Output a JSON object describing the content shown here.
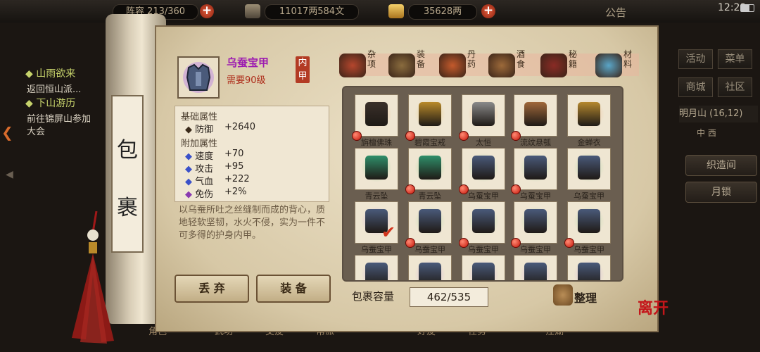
{
  "topbar": {
    "partial_text": "阵容 213/360",
    "money": "11017两584文",
    "gold": "35628两",
    "notice": "公告",
    "time": "12:29"
  },
  "quests": [
    {
      "title": "◆ 山雨欲来",
      "sub": "返回恒山派..."
    },
    {
      "title": "◆ 下山游历",
      "sub": "前往锦屏山参加",
      "sub2": "大会"
    }
  ],
  "right_menu": {
    "row1": [
      "活动",
      "菜单"
    ],
    "row2": [
      "商城",
      "社区"
    ],
    "location": "明月山 (16,12)",
    "compass": "中 西",
    "buttons": [
      "织造间",
      "月锁"
    ]
  },
  "bottom_nav": [
    "角色",
    "武功",
    "交友",
    "帮派",
    "好友",
    "任务",
    "江湖",
    "离开"
  ],
  "scroll": {
    "title1": "包",
    "title2": "裹"
  },
  "item": {
    "name": "乌蚕宝甲",
    "level": "需要90级",
    "type": "内甲",
    "base_header": "基础属性",
    "base": [
      {
        "name": "防御",
        "value": "+2640"
      }
    ],
    "extra_header": "附加属性",
    "extra": [
      {
        "name": "速度",
        "value": "+70"
      },
      {
        "name": "攻击",
        "value": "+95"
      },
      {
        "name": "气血",
        "value": "+222"
      },
      {
        "name": "免伤",
        "value": "+2%"
      }
    ],
    "description": "以乌蚕所吐之丝缝制而成的背心，质地轻软坚韧，水火不侵，实为一件不可多得的护身内甲。"
  },
  "actions": {
    "discard": "丢 弃",
    "equip": "装 备"
  },
  "tabs": [
    {
      "label": "杂项",
      "color": "#b5462d"
    },
    {
      "label": "装备",
      "color": "#8a6c3e"
    },
    {
      "label": "丹药",
      "color": "#c45a2c"
    },
    {
      "label": "酒食",
      "color": "#9d6a3a"
    },
    {
      "label": "秘籍",
      "color": "#8a2b25"
    },
    {
      "label": "材料",
      "color": "#5aa6c8"
    }
  ],
  "grid": [
    {
      "name": "旃檀佛珠",
      "icon": "beads-icon",
      "glow": "#f2b07b",
      "color": "#3a302a",
      "dot": true
    },
    {
      "name": "碧霞宝戒",
      "icon": "ring-icon",
      "glow": "#e9c36a",
      "color": "#b98a2a",
      "dot": true
    },
    {
      "name": "太恒",
      "icon": "dagger-icon",
      "glow": "#f2b07b",
      "color": "#8a8a8a",
      "dot": true
    },
    {
      "name": "流纹悬瓠",
      "icon": "gourd-icon",
      "glow": "#e6c89a",
      "color": "#a0683a",
      "dot": true
    },
    {
      "name": "金蝉衣",
      "icon": "robe-icon",
      "glow": "#f2b07b",
      "color": "#b5882e",
      "dot": false
    },
    {
      "name": "青云坠",
      "icon": "pendant-icon",
      "glow": "#8dd08a",
      "color": "#2f8f6a",
      "dot": false
    },
    {
      "name": "青云坠",
      "icon": "pendant-icon",
      "glow": "#8dd08a",
      "color": "#2f8f6a",
      "dot": true
    },
    {
      "name": "乌蚕宝甲",
      "icon": "armor-icon",
      "glow": "#a2d39a",
      "color": "#4a5a7a",
      "dot": true
    },
    {
      "name": "乌蚕宝甲",
      "icon": "armor-icon",
      "glow": "#a2d39a",
      "color": "#4a5a7a",
      "dot": true
    },
    {
      "name": "乌蚕宝甲",
      "icon": "armor-icon",
      "glow": "#a2d39a",
      "color": "#4a5a7a",
      "dot": false
    },
    {
      "name": "乌蚕宝甲",
      "icon": "armor-icon",
      "glow": "#c7a0d8",
      "color": "#4a5a7a",
      "dot": false,
      "check": true
    },
    {
      "name": "乌蚕宝甲",
      "icon": "armor-icon",
      "glow": "#a2d39a",
      "color": "#4a5a7a",
      "dot": true
    },
    {
      "name": "乌蚕宝甲",
      "icon": "armor-icon",
      "glow": "#a2d39a",
      "color": "#4a5a7a",
      "dot": true
    },
    {
      "name": "乌蚕宝甲",
      "icon": "armor-icon",
      "glow": "#a2d39a",
      "color": "#4a5a7a",
      "dot": true
    },
    {
      "name": "乌蚕宝甲",
      "icon": "armor-icon",
      "glow": "#a2d39a",
      "color": "#4a5a7a",
      "dot": true
    },
    {
      "name": "",
      "icon": "armor-icon",
      "glow": "#c7a0d8",
      "color": "#4a5a7a",
      "dot": false
    },
    {
      "name": "",
      "icon": "armor-icon",
      "glow": "#c7a0d8",
      "color": "#4a5a7a",
      "dot": true
    },
    {
      "name": "",
      "icon": "armor-icon",
      "glow": "#c7a0d8",
      "color": "#4a5a7a",
      "dot": true
    },
    {
      "name": "",
      "icon": "armor-icon",
      "glow": "#c7a0d8",
      "color": "#4a5a7a",
      "dot": true
    },
    {
      "name": "",
      "icon": "armor-icon",
      "glow": "#c7a0d8",
      "color": "#4a5a7a",
      "dot": true
    }
  ],
  "capacity": {
    "label": "包裹容量",
    "value": "462/535"
  },
  "sort_label": "整理",
  "leave_label": "离开"
}
